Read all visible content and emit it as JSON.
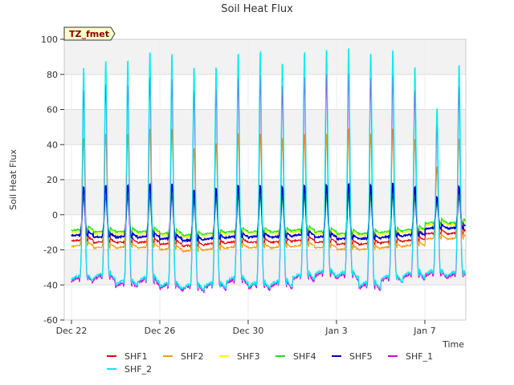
{
  "chart_data": {
    "type": "line",
    "title": "Soil Heat Flux",
    "xlabel": "Time",
    "ylabel": "Soil Heat Flux",
    "ylim": [
      -60,
      100
    ],
    "yticks": [
      -60,
      -40,
      -20,
      0,
      20,
      40,
      60,
      80,
      100
    ],
    "xlim_days": [
      0,
      18.2
    ],
    "xticks": [
      {
        "label": "Dec 22",
        "day": 0
      },
      {
        "label": "Dec 26",
        "day": 4
      },
      {
        "label": "Dec 30",
        "day": 8
      },
      {
        "label": "Jan 3",
        "day": 12
      },
      {
        "label": "Jan 7",
        "day": 16
      }
    ],
    "grid": true,
    "legend_position": "bottom",
    "annotation": "TZ_fmet",
    "daily_peaks": {
      "days": [
        "Dec 22",
        "Dec 23",
        "Dec 24",
        "Dec 25",
        "Dec 26",
        "Dec 27",
        "Dec 28",
        "Dec 29",
        "Dec 30",
        "Dec 31",
        "Jan 1",
        "Jan 2",
        "Jan 3",
        "Jan 4",
        "Jan 5",
        "Jan 6",
        "Jan 7",
        "Jan 8"
      ],
      "SHF_2_peak": [
        85,
        89,
        89,
        94,
        93,
        85,
        86,
        93,
        95,
        88,
        94,
        96,
        97,
        94,
        95,
        85,
        62,
        87
      ],
      "SHF_2_night": [
        -37,
        -36,
        -40,
        -38,
        -41,
        -42,
        -41,
        -38,
        -41,
        -40,
        -36,
        -34,
        -35,
        -41,
        -37,
        -35,
        -34,
        -35
      ],
      "SHF5_peak": [
        16,
        17,
        17,
        18,
        18,
        14,
        15,
        17,
        17,
        16,
        17,
        17,
        18,
        17,
        18,
        16,
        10,
        16
      ],
      "SHF5_night": [
        -12,
        -13,
        -13,
        -13,
        -14,
        -15,
        -14,
        -13,
        -13,
        -13,
        -12,
        -13,
        -14,
        -14,
        -13,
        -12,
        -8,
        -8
      ]
    },
    "series": [
      {
        "name": "SHF1",
        "color": "#e8000b",
        "peak_scale": 0.2,
        "night_offset": -3
      },
      {
        "name": "SHF2",
        "color": "#f39c12",
        "peak_scale": 0.55,
        "night_offset": -6
      },
      {
        "name": "SHF3",
        "color": "#ffff00",
        "peak_scale": 0.15,
        "night_offset": 2
      },
      {
        "name": "SHF4",
        "color": "#22dd22",
        "peak_scale": 0.12,
        "night_offset": 3
      },
      {
        "name": "SHF5",
        "color": "#0000cc",
        "peak_scale": 0.2,
        "night_offset": 0
      },
      {
        "name": "SHF_1",
        "color": "#dd00dd",
        "peak_scale": 0.85,
        "night_offset": -26
      },
      {
        "name": "SHF_2",
        "color": "#00eeee",
        "peak_scale": 1.0,
        "night_offset": -26
      }
    ]
  }
}
